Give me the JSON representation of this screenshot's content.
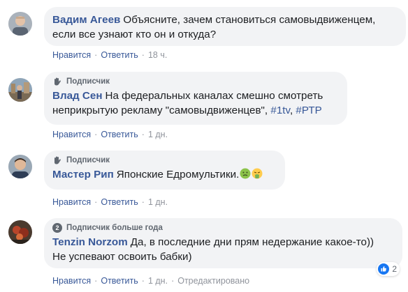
{
  "comments": [
    {
      "badge": "",
      "author": "Вадим Агеев",
      "text_line1": "Объясните, зачем становиться самовыдвиженцем,",
      "text_line2": "если все узнают кто он и откуда?",
      "like": "Нравится",
      "reply": "Ответить",
      "time": "18 ч."
    },
    {
      "badge": "Подписчик",
      "author": "Влад Сен",
      "text_line1": "На федеральных каналах смешно смотреть",
      "text_line2": "неприкрытую рекламу \"самовыдвиженцев\",",
      "hashtag1": "#1tv",
      "hashtag2": "#РТР",
      "like": "Нравится",
      "reply": "Ответить",
      "time": "1 дн."
    },
    {
      "badge": "Подписчик",
      "author": "Мастер Рип",
      "text_line1": "Японские Едромультики.",
      "emoji1": "nauseated-face",
      "emoji2": "face-vomiting",
      "like": "Нравится",
      "reply": "Ответить",
      "time": "1 дн."
    },
    {
      "badge_number": "2",
      "badge": "Подписчик больше года",
      "author": "Tenzin Norzom",
      "text_line1": "Да, в последние дни прям недержание какое-то))",
      "text_line2": "Не успевают освоить бабки)",
      "like": "Нравится",
      "reply": "Ответить",
      "time": "1 дн.",
      "edited": "Отредактировано",
      "reaction_icon": "like-icon",
      "reaction_count": "2"
    }
  ],
  "colors": {
    "link": "#385898",
    "bubble": "#f2f3f5",
    "meta": "#90949c",
    "like_blue": "#1877f2"
  }
}
